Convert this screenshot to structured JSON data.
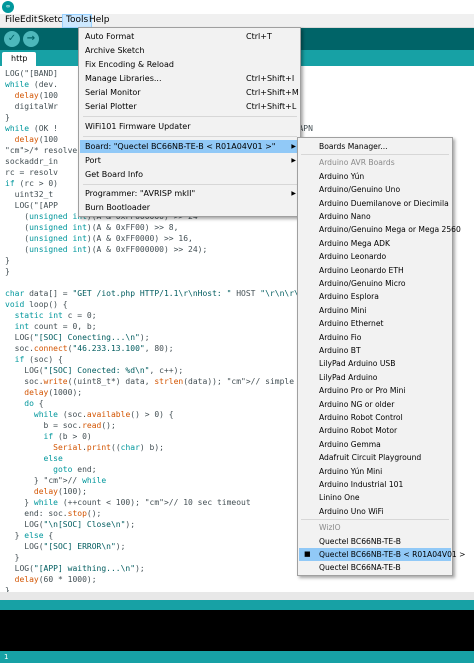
{
  "titlebar": {
    "app_icon": "arduino-icon"
  },
  "menubar": [
    "File",
    "Edit",
    "Sketch",
    "Tools",
    "Help"
  ],
  "toolbar": {
    "buttons": [
      {
        "name": "verify",
        "glyph": "✓"
      },
      {
        "name": "upload",
        "glyph": "→"
      }
    ]
  },
  "tab": {
    "label": "http"
  },
  "code": {
    "lines": [
      "LOG(\"[BAND]",
      "while (dev.",
      "  delay(100",
      "  digitalWr",
      "}",
      "while (OK !",
      "  delay(100",
      "/* resolve",
      "sockaddr_in",
      "rc = resolv",
      "if (rc > 0)",
      "  uint32_t",
      "  LOG(\"[APP",
      "    (unsigned int)(A & 0xFF000000) >> 24",
      "    (unsigned int)(A & 0xFF00) >> 8,",
      "    (unsigned int)(A & 0xFF0000) >> 16,",
      "    (unsigned int)(A & 0xFF000000) >> 24);",
      "}",
      "}",
      "",
      "char data[] = \"GET /iot.php HTTP/1.1\\r\\nHost: \" HOST \"\\r\\n\\r\\n\";",
      "void loop() {",
      "  static int c = 0;",
      "  int count = 0, b;",
      "  LOG(\"[SOC] Conecting...\\n\");",
      "  soc.connect(\"46.233.13.100\", 80);",
      "  if (soc) {",
      "    LOG(\"[SOC] Conected: %d\\n\", c++);",
      "    soc.write((uint8_t*) data, strlen(data)); // simple http get",
      "    delay(1000);",
      "    do {",
      "      while (soc.available() > 0) {",
      "        b = soc.read();",
      "        if (b > 0)",
      "          Serial.print((char) b);",
      "        else",
      "          goto end;",
      "      } // while",
      "      delay(100);",
      "    } while (++count < 100); // 10 sec timeout",
      "    end: soc.stop();",
      "    LOG(\"\\n[SOC] Close\\n\");",
      "  } else {",
      "    LOG(\"[SOC] ERROR\\n\");",
      "  }",
      "  LOG(\"[APP] waithing...\\n\");",
      "  delay(60 * 1000);",
      "}"
    ],
    "peek": "st APN"
  },
  "tools_menu": {
    "items": [
      {
        "label": "Auto Format",
        "shortcut": "Ctrl+T"
      },
      {
        "label": "Archive Sketch",
        "shortcut": ""
      },
      {
        "label": "Fix Encoding & Reload",
        "shortcut": ""
      },
      {
        "label": "Manage Libraries...",
        "shortcut": "Ctrl+Shift+I"
      },
      {
        "label": "Serial Monitor",
        "shortcut": "Ctrl+Shift+M"
      },
      {
        "label": "Serial Plotter",
        "shortcut": "Ctrl+Shift+L"
      },
      {
        "label": "WiFi101 Firmware Updater",
        "shortcut": ""
      },
      {
        "label": "Board: \"Quectel BC66NB-TE-B < R01A04V01 >\"",
        "shortcut": ""
      },
      {
        "label": "Port",
        "shortcut": ""
      },
      {
        "label": "Get Board Info",
        "shortcut": ""
      },
      {
        "label": "Programmer: \"AVRISP mkII\"",
        "shortcut": ""
      },
      {
        "label": "Burn Bootloader",
        "shortcut": ""
      }
    ]
  },
  "boards_menu": {
    "items": [
      "Boards Manager...",
      "Arduino AVR Boards",
      "Arduino Yún",
      "Arduino/Genuino Uno",
      "Arduino Duemilanove or Diecimila",
      "Arduino Nano",
      "Arduino/Genuino Mega or Mega 2560",
      "Arduino Mega ADK",
      "Arduino Leonardo",
      "Arduino Leonardo ETH",
      "Arduino/Genuino Micro",
      "Arduino Esplora",
      "Arduino Mini",
      "Arduino Ethernet",
      "Arduino Fio",
      "Arduino BT",
      "LilyPad Arduino USB",
      "LilyPad Arduino",
      "Arduino Pro or Pro Mini",
      "Arduino NG or older",
      "Arduino Robot Control",
      "Arduino Robot Motor",
      "Arduino Gemma",
      "Adafruit Circuit Playground",
      "Arduino Yún Mini",
      "Arduino Industrial 101",
      "Linino One",
      "Arduino Uno WiFi",
      "WizIO",
      "Quectel BC66NB-TE-B",
      "Quectel BC66NB-TE-B < R01A04V01 >",
      "Quectel BC66NA-TE-B"
    ],
    "selected_mark": "■"
  },
  "status": {
    "line_number": "1"
  }
}
